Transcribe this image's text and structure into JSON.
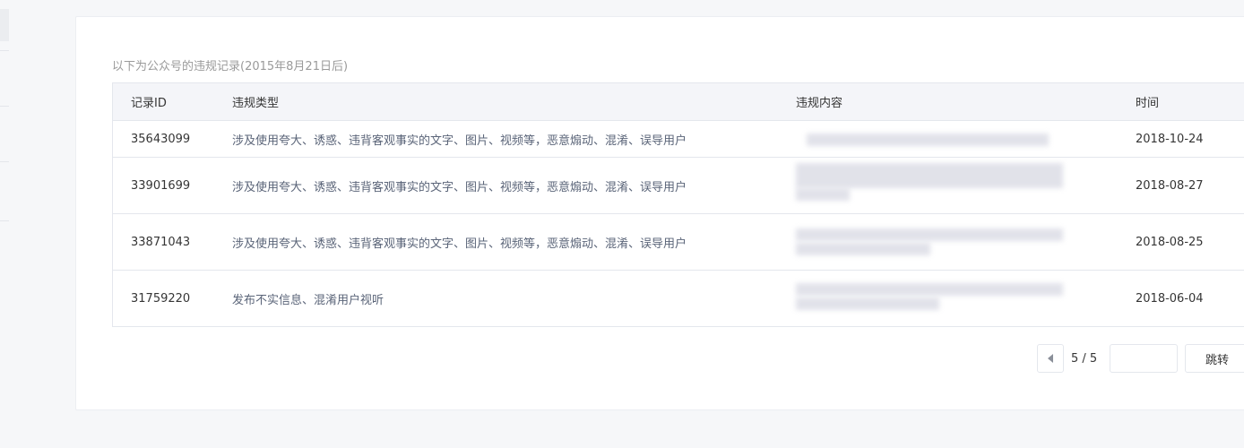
{
  "caption": "以下为公众号的违规记录(2015年8月21日后)",
  "table": {
    "headers": {
      "id": "记录ID",
      "type": "违规类型",
      "content": "违规内容",
      "time": "时间"
    },
    "rows": [
      {
        "id": "35643099",
        "type": "涉及使用夸大、诱惑、违背客观事实的文字、图片、视频等，恶意煽动、混淆、误导用户",
        "time": "2018-10-24"
      },
      {
        "id": "33901699",
        "type": "涉及使用夸大、诱惑、违背客观事实的文字、图片、视频等，恶意煽动、混淆、误导用户",
        "time": "2018-08-27"
      },
      {
        "id": "33871043",
        "type": "涉及使用夸大、诱惑、违背客观事实的文字、图片、视频等，恶意煽动、混淆、误导用户",
        "time": "2018-08-25"
      },
      {
        "id": "31759220",
        "type": "发布不实信息、混淆用户视听",
        "time": "2018-06-04"
      }
    ]
  },
  "pager": {
    "current": "5 / 5",
    "jump_label": "跳转",
    "jump_value": ""
  },
  "colors": {
    "panel": "#ffffff",
    "header_bg": "#f4f5f9",
    "link_text": "#5a6478",
    "border": "#e4e7ed"
  }
}
